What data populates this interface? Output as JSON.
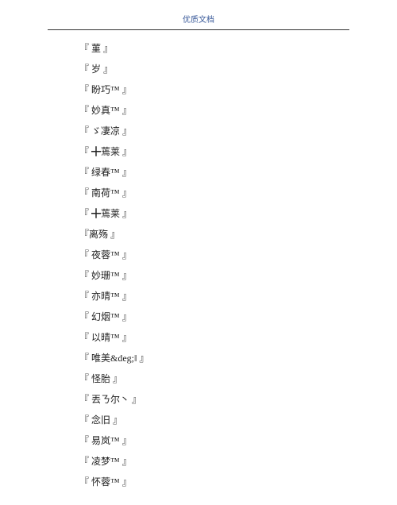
{
  "header": {
    "title": "优质文档"
  },
  "entries": [
    "『 菫 』",
    "『 岁 』",
    "『 盼巧™ 』",
    "『 妙真™ 』",
    "『 ゞ凄凉 』",
    "『 ╋蔫莱 』",
    "『 绿春™ 』",
    "『 南荷™ 』",
    "『 ╋蔫莱 』",
    "『离殇 』",
    "『 夜蓉™ 』",
    "『 妙珊™ 』",
    "『 亦晴™ 』",
    "『 幻烟™ 』",
    "『 以晴™ 』",
    "『 唯美&deg;‖ 』",
    "『 怪胎 』",
    "『 丟ㄋ尔丶 』",
    "『 念旧 』",
    "『 易岚™ 』",
    "『 凌梦™ 』",
    "『 怀蓉™ 』"
  ]
}
